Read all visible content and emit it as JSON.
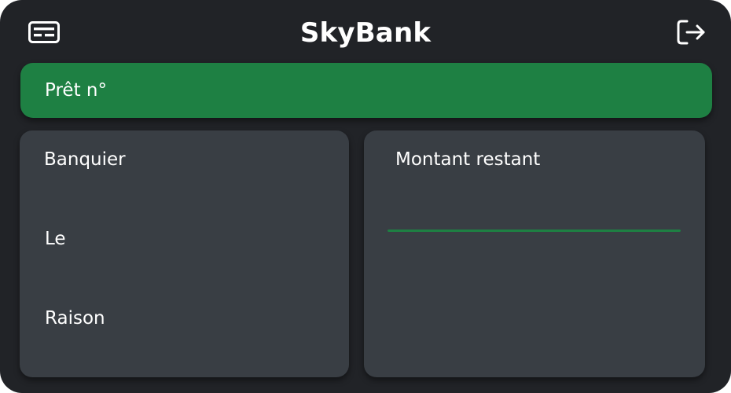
{
  "app": {
    "title": "SkyBank"
  },
  "header": {
    "left_icon": "id-card-icon",
    "right_icon": "logout-icon"
  },
  "loan": {
    "label": "Prêt n°"
  },
  "details": {
    "banker_label": "Banquier",
    "date_label": "Le",
    "reason_label": "Raison"
  },
  "amount": {
    "label": "Montant restant",
    "progress_fraction": 1.0
  },
  "colors": {
    "background": "#212327",
    "panel": "#393e44",
    "accent_green": "#1e8043",
    "text": "#ffffff"
  }
}
